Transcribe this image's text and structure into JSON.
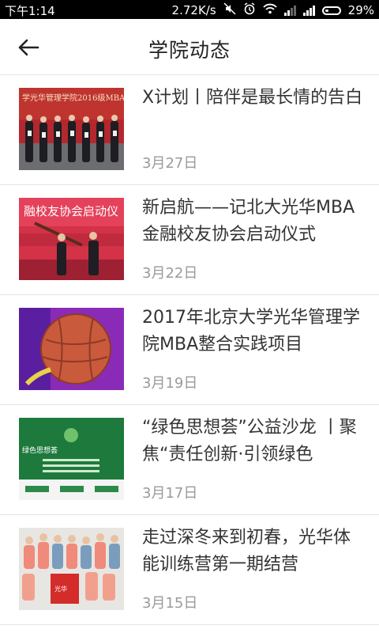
{
  "status_bar": {
    "time": "下午1:14",
    "network_speed": "2.72K/s",
    "battery_percent": "29%",
    "icons": [
      "mute-icon",
      "alarm-icon",
      "wifi-icon",
      "signal-icon",
      "signal-icon",
      "battery-icon"
    ]
  },
  "header": {
    "back_icon": "arrow-left-icon",
    "title": "学院动态"
  },
  "news": [
    {
      "title": "X计划丨陪伴是最长情的告白",
      "date": "3月27日",
      "thumb_caption": "学光华管理学院2016级MBA 校友导师启动仪式"
    },
    {
      "title": "新启航——记北大光华MBA 金融校友协会启动仪式",
      "date": "3月22日",
      "thumb_caption": "融校友协会启动仪"
    },
    {
      "title": "2017年北京大学光华管理学院MBA整合实践项目",
      "date": "3月19日",
      "thumb_caption": ""
    },
    {
      "title": "“绿色思想荟”公益沙龙 丨聚焦“责任创新·引领绿色",
      "date": "3月17日",
      "thumb_caption": "绿色思想荟"
    },
    {
      "title": "走过深冬来到初春，光华体能训练营第一期结营",
      "date": "3月15日",
      "thumb_caption": ""
    }
  ],
  "colors": {
    "title": "#222222",
    "headline": "#333333",
    "date": "#9a9a9a",
    "divider": "#e3e3e3"
  }
}
